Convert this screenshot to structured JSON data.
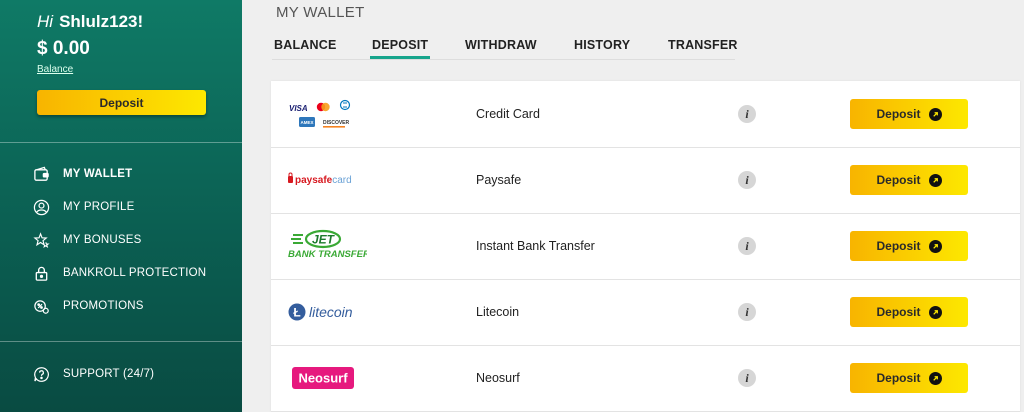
{
  "user": {
    "greeting": "Hi",
    "username": "Shlulz123!",
    "balance_amount": "$ 0.00",
    "balance_label": "Balance",
    "deposit_label": "Deposit"
  },
  "nav": {
    "items": [
      {
        "label": "MY WALLET",
        "icon": "wallet-icon",
        "active": true
      },
      {
        "label": "MY PROFILE",
        "icon": "user-icon",
        "active": false
      },
      {
        "label": "MY BONUSES",
        "icon": "stars-icon",
        "active": false
      },
      {
        "label": "BANKROLL PROTECTION",
        "icon": "lock-icon",
        "active": false
      },
      {
        "label": "PROMOTIONS",
        "icon": "promotions-icon",
        "active": false
      }
    ],
    "support": {
      "label": "SUPPORT (24/7)",
      "icon": "help-icon"
    }
  },
  "page": {
    "title": "MY WALLET",
    "tabs": [
      {
        "label": "BALANCE",
        "active": false
      },
      {
        "label": "DEPOSIT",
        "active": true
      },
      {
        "label": "WITHDRAW",
        "active": false
      },
      {
        "label": "HISTORY",
        "active": false
      },
      {
        "label": "TRANSFER",
        "active": false
      }
    ]
  },
  "methods": [
    {
      "name": "Credit Card",
      "logo": "credit-card-logos",
      "info": "i",
      "button": "Deposit",
      "logo_text": [
        "VISA",
        "DISCOVER"
      ]
    },
    {
      "name": "Paysafe",
      "logo": "paysafecard-logo",
      "info": "i",
      "button": "Deposit",
      "logo_text": [
        "paysafe",
        "card"
      ]
    },
    {
      "name": "Instant Bank Transfer",
      "logo": "jet-bank-transfer-logo",
      "info": "i",
      "button": "Deposit",
      "logo_text": [
        "JET",
        "BANK TRANSFER"
      ]
    },
    {
      "name": "Litecoin",
      "logo": "litecoin-logo",
      "info": "i",
      "button": "Deposit",
      "logo_text": [
        "litecoin"
      ]
    },
    {
      "name": "Neosurf",
      "logo": "neosurf-logo",
      "info": "i",
      "button": "Deposit",
      "logo_text": [
        "Neosurf"
      ]
    }
  ],
  "colors": {
    "sidebar_top": "#0f7a66",
    "sidebar_bottom": "#094b42",
    "accent": "#17a58c",
    "button_start": "#f8b400",
    "button_end": "#fde800"
  }
}
